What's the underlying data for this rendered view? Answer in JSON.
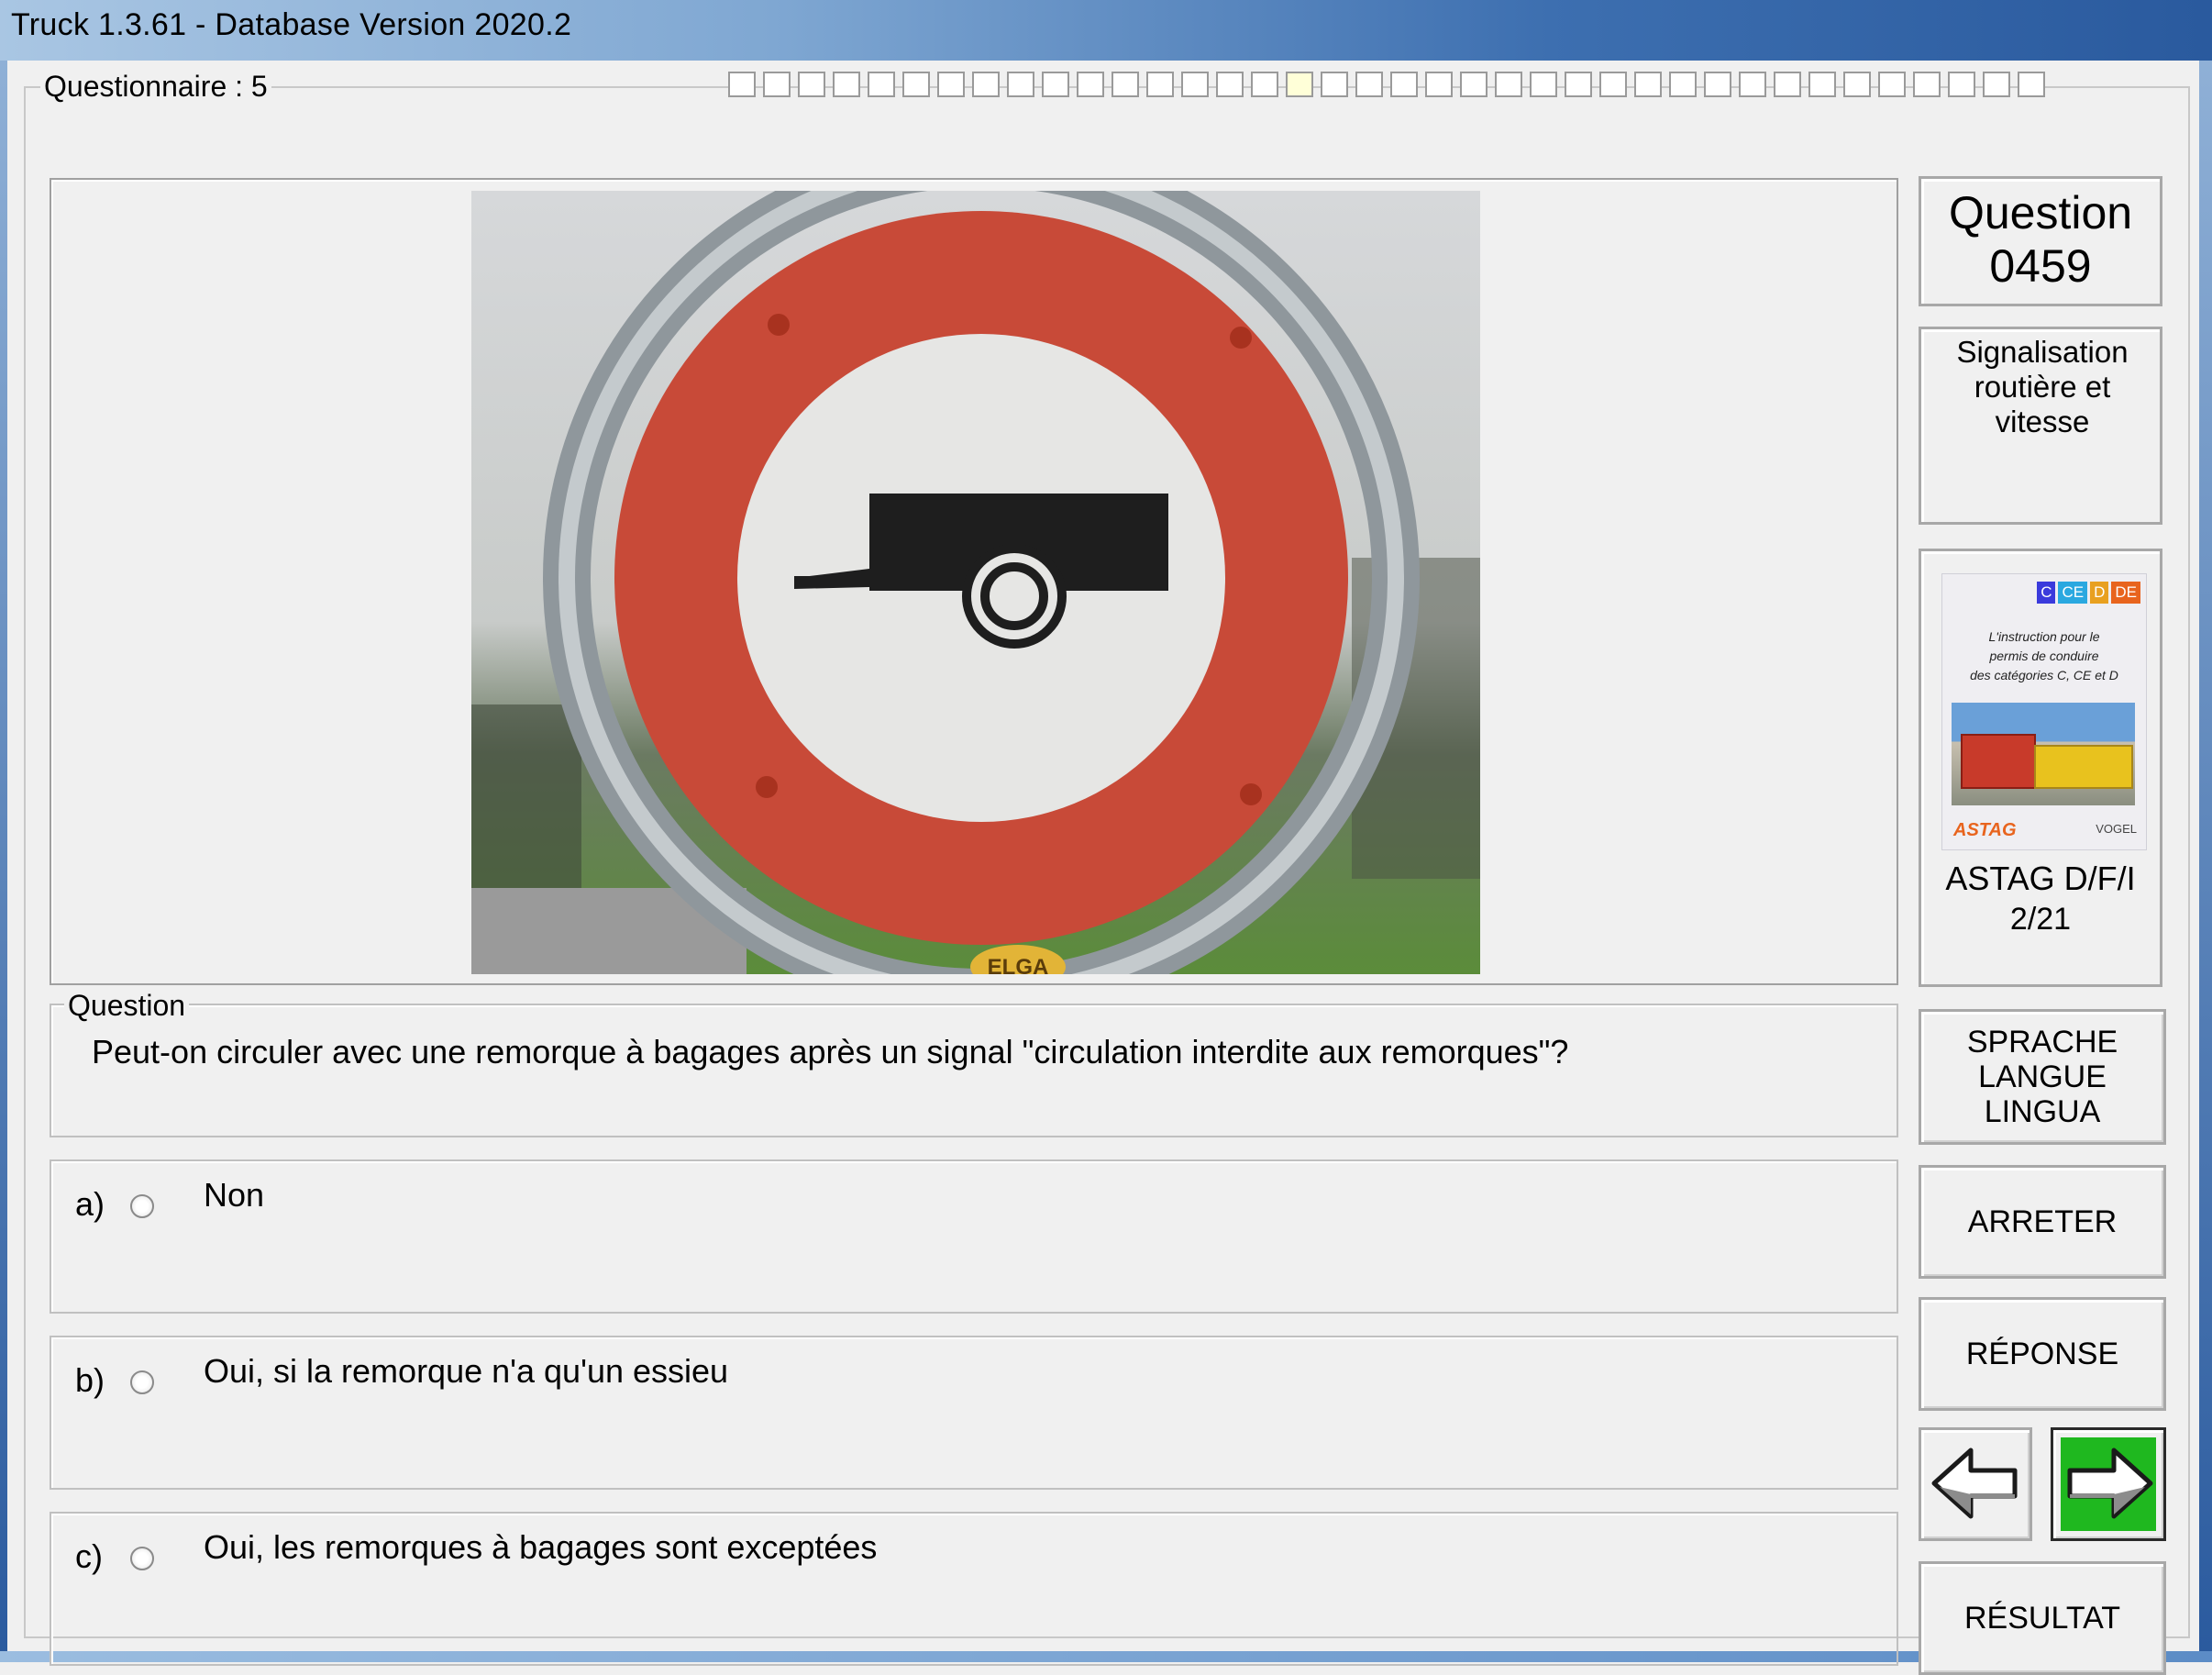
{
  "window": {
    "title": "Truck 1.3.61 - Database Version 2020.2"
  },
  "questionnaire": {
    "label": "Questionnaire : 5",
    "progress_total_cells": 38,
    "progress_current_cell": 16
  },
  "question": {
    "section_label": "Question",
    "text": "Peut-on circuler avec une remorque à bagages après un signal \"circulation interdite aux remorques\"?",
    "sign_plate_text": "ELGA"
  },
  "answers": [
    {
      "letter": "a)",
      "text": "Non"
    },
    {
      "letter": "b)",
      "text": "Oui, si la remorque n'a qu'un essieu"
    },
    {
      "letter": "c)",
      "text": "Oui, les remorques à bagages sont exceptées"
    }
  ],
  "side": {
    "question_label": "Question",
    "question_number": "0459",
    "category_line1": "Signalisation",
    "category_line2": "routière et vitesse",
    "book": {
      "tags": [
        "C",
        "CE",
        "D",
        "DE"
      ],
      "text_line1": "L'instruction pour le",
      "text_line2": "permis de conduire",
      "text_line3": "des catégories C, CE et D",
      "logo_left": "ASTAG",
      "logo_right": "VOGEL"
    },
    "source_line1": "ASTAG D/F/I",
    "source_line2": "2/21"
  },
  "buttons": {
    "lang_line1": "SPRACHE",
    "lang_line2": "LANGUE",
    "lang_line3": "LINGUA",
    "stop": "ARRETER",
    "answer": "RÉPONSE",
    "result": "RÉSULTAT"
  },
  "icons": {
    "prev": "arrow-left-icon",
    "next": "arrow-right-icon"
  },
  "colors": {
    "next_button_green": "#1fb81f",
    "sign_red": "#c84a38",
    "progress_current": "#ffffd8"
  }
}
